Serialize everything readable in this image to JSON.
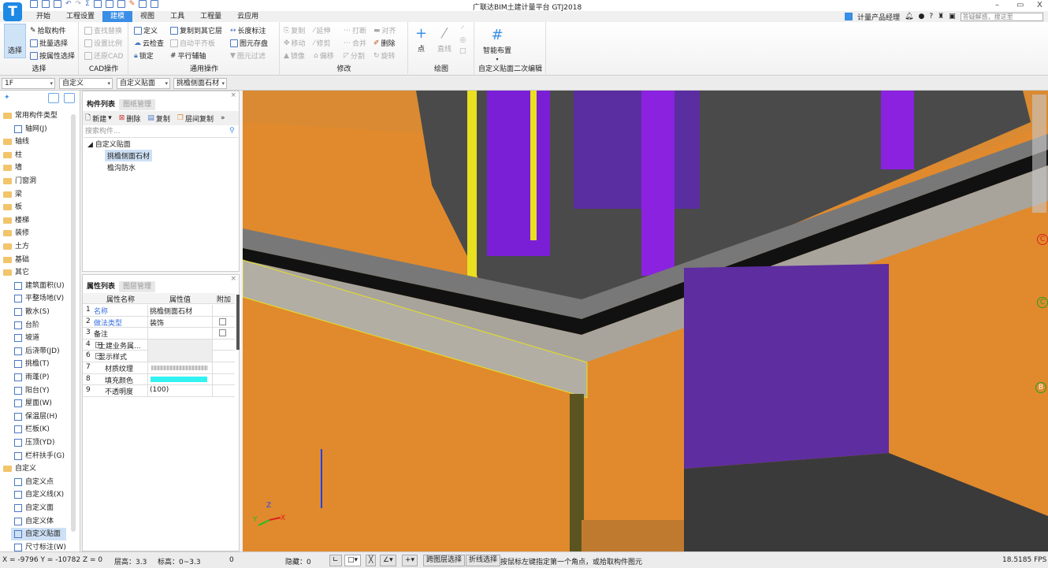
{
  "app": {
    "title": "广联达BIM土建计量平台 GTJ2018",
    "logo": "T",
    "window_controls": [
      "–",
      "▭",
      "X"
    ]
  },
  "quick_access": [
    "save-icon",
    "save-as-icon",
    "open-icon",
    "undo-icon",
    "redo-icon",
    "sum-icon",
    "report-icon",
    "view-icon",
    "calc-icon",
    "edit-icon",
    "grid-icon",
    "file-icon"
  ],
  "tabs": [
    {
      "label": "开始"
    },
    {
      "label": "工程设置"
    },
    {
      "label": "建模",
      "active": true
    },
    {
      "label": "视图"
    },
    {
      "label": "工具"
    },
    {
      "label": "工程量"
    },
    {
      "label": "云应用"
    }
  ],
  "userbar": {
    "user": "计量产品经理",
    "help": "?",
    "search_placeholder": "答疑解惑，搜这里"
  },
  "ribbon": {
    "select": {
      "label": "选择",
      "big": "选择",
      "items": [
        "拾取构件",
        "批量选择",
        "按属性选择"
      ]
    },
    "cad": {
      "label": "CAD操作",
      "items": [
        "查找替换",
        "设置比例",
        "还原CAD"
      ]
    },
    "general": {
      "label": "通用操作",
      "col1": [
        "定义",
        "云检查",
        "锁定"
      ],
      "col2": [
        "复制到其它层",
        "自动平齐板",
        "平行辅轴"
      ],
      "col3": [
        "长度标注",
        "图元存盘",
        "图元过滤"
      ]
    },
    "modify": {
      "label": "修改",
      "col1": [
        "复制",
        "移动",
        "镜像"
      ],
      "col2": [
        "延伸",
        "修剪",
        "偏移"
      ],
      "col3": [
        "打断",
        "合并",
        "分割"
      ],
      "col4": [
        "对齐",
        "删除",
        "旋转"
      ]
    },
    "draw": {
      "label": "绘图",
      "items": [
        "点",
        "直线"
      ]
    },
    "custom": {
      "label": "自定义贴面二次编辑",
      "items": [
        "智能布置"
      ]
    }
  },
  "combos": [
    "1F",
    "自定义",
    "自定义贴面",
    "挑檐侧面石材"
  ],
  "left_tree": [
    {
      "label": "常用构件类型",
      "type": "folder-open"
    },
    {
      "label": "轴网(J)",
      "type": "leaf"
    },
    {
      "label": "轴线",
      "type": "folder"
    },
    {
      "label": "柱",
      "type": "folder"
    },
    {
      "label": "墙",
      "type": "folder"
    },
    {
      "label": "门窗洞",
      "type": "folder"
    },
    {
      "label": "梁",
      "type": "folder"
    },
    {
      "label": "板",
      "type": "folder"
    },
    {
      "label": "楼梯",
      "type": "folder"
    },
    {
      "label": "装修",
      "type": "folder"
    },
    {
      "label": "土方",
      "type": "folder"
    },
    {
      "label": "基础",
      "type": "folder"
    },
    {
      "label": "其它",
      "type": "folder-open"
    },
    {
      "label": "建筑面积(U)",
      "type": "leaf"
    },
    {
      "label": "平整场地(V)",
      "type": "leaf"
    },
    {
      "label": "散水(S)",
      "type": "leaf"
    },
    {
      "label": "台阶",
      "type": "leaf"
    },
    {
      "label": "坡道",
      "type": "leaf"
    },
    {
      "label": "后浇带(JD)",
      "type": "leaf"
    },
    {
      "label": "挑檐(T)",
      "type": "leaf"
    },
    {
      "label": "雨蓬(P)",
      "type": "leaf"
    },
    {
      "label": "阳台(Y)",
      "type": "leaf"
    },
    {
      "label": "屋面(W)",
      "type": "leaf"
    },
    {
      "label": "保温层(H)",
      "type": "leaf"
    },
    {
      "label": "栏板(K)",
      "type": "leaf"
    },
    {
      "label": "压顶(YD)",
      "type": "leaf"
    },
    {
      "label": "栏杆扶手(G)",
      "type": "leaf"
    },
    {
      "label": "自定义",
      "type": "folder-open"
    },
    {
      "label": "自定义点",
      "type": "leaf"
    },
    {
      "label": "自定义线(X)",
      "type": "leaf"
    },
    {
      "label": "自定义面",
      "type": "leaf"
    },
    {
      "label": "自定义体",
      "type": "leaf"
    },
    {
      "label": "自定义贴面",
      "type": "leaf",
      "selected": true
    },
    {
      "label": "尺寸标注(W)",
      "type": "leaf"
    }
  ],
  "component_panel": {
    "tabs": [
      "构件列表",
      "图纸管理"
    ],
    "toolbar": [
      "新建",
      "删除",
      "复制",
      "层间复制"
    ],
    "search_placeholder": "搜索构件...",
    "group": "自定义贴面",
    "items": [
      {
        "label": "挑檐侧面石材",
        "selected": true
      },
      {
        "label": "檐沟防水"
      }
    ]
  },
  "property_panel": {
    "tabs": [
      "属性列表",
      "图层管理"
    ],
    "headers": [
      "属性名称",
      "属性值",
      "附加"
    ],
    "rows": [
      {
        "n": "1",
        "name": "名称",
        "value": "挑檐侧面石材",
        "link": true
      },
      {
        "n": "2",
        "name": "做法类型",
        "value": "装饰",
        "link": true,
        "check": true
      },
      {
        "n": "3",
        "name": "备注",
        "value": "",
        "check": true
      },
      {
        "n": "4",
        "name": "土建业务属...",
        "value": "",
        "expand": "+"
      },
      {
        "n": "6",
        "name": "显示样式",
        "value": "",
        "expand": "−"
      },
      {
        "n": "7",
        "name": "材质纹理",
        "value": "",
        "texture": true
      },
      {
        "n": "8",
        "name": "填充颜色",
        "value": "",
        "color": "#33f2f2"
      },
      {
        "n": "9",
        "name": "不透明度",
        "value": "(100)"
      }
    ]
  },
  "viewport": {
    "axis_labels": [
      "Z",
      "Y",
      "X"
    ],
    "grid_labels": [
      "C",
      "C",
      "B"
    ]
  },
  "status": {
    "coords": "X = -9796 Y = -10782 Z = 0",
    "floor_height": "层高：3.3",
    "elevation": "标高：0~3.3",
    "count": "0",
    "hidden": "隐藏：0",
    "cross_layer": "跨图层选择",
    "polyline": "折线选择",
    "hint": "按鼠标左键指定第一个角点，或拾取构件图元",
    "fps": "18.5185 FPS"
  }
}
